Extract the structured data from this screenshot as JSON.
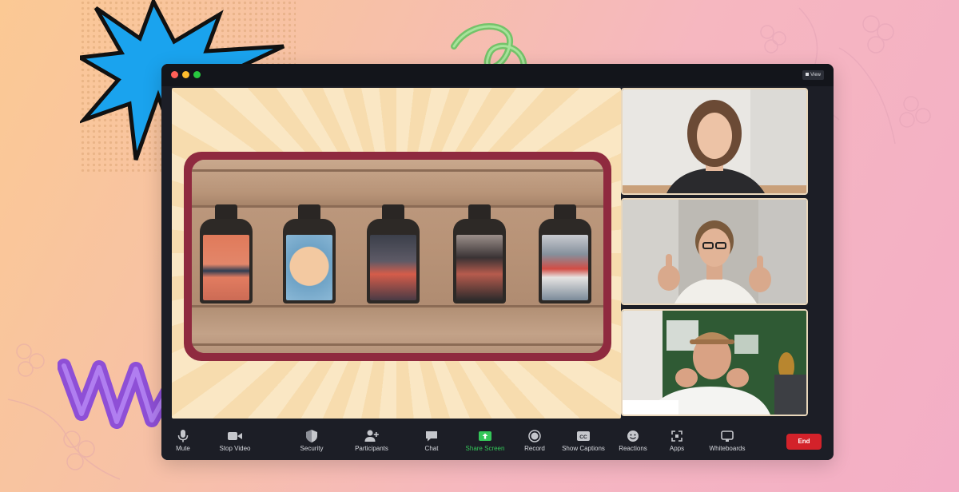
{
  "window": {
    "view_button": "View"
  },
  "toolbar": {
    "mute": "Mute",
    "stop_video": "Stop Video",
    "security": "Security",
    "participants": "Participants",
    "chat": "Chat",
    "share_screen": "Share Screen",
    "record": "Record",
    "show_captions": "Show Captions",
    "reactions": "Reactions",
    "apps": "Apps",
    "whiteboards": "Whiteboards",
    "end": "End"
  },
  "colors": {
    "accent_green": "#34c759",
    "end_red": "#d3222a",
    "frame_maroon": "#8f2a3f",
    "window_bg": "#1c1e26"
  },
  "icons": [
    "microphone-icon",
    "video-camera-icon",
    "shield-icon",
    "participants-icon",
    "chat-bubble-icon",
    "share-screen-icon",
    "record-icon",
    "captions-icon",
    "reactions-icon",
    "apps-icon",
    "whiteboard-icon"
  ]
}
